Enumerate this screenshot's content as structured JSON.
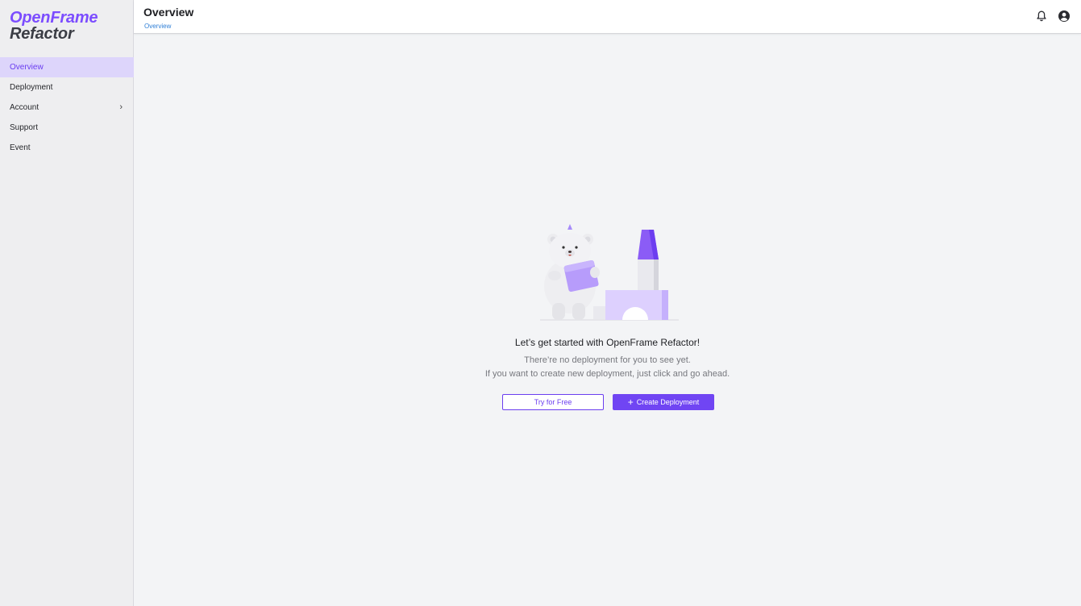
{
  "brand": {
    "line1": "OpenFrame",
    "line2": "Refactor",
    "accent": "#7c4dff"
  },
  "sidebar": {
    "items": [
      {
        "label": "Overview",
        "active": true
      },
      {
        "label": "Deployment"
      },
      {
        "label": "Account",
        "chevron": "chevron-right-icon"
      },
      {
        "label": "Support"
      },
      {
        "label": "Event"
      }
    ]
  },
  "header": {
    "title": "Overview",
    "breadcrumb": "Overview",
    "icons": [
      "bell-icon",
      "user-avatar-icon"
    ]
  },
  "empty_state": {
    "headline": "Let’s get started with OpenFrame Refactor!",
    "line1": "There’re no deployment for you to see yet.",
    "line2": "If you want to create new deployment, just click and go ahead.",
    "try_label": "Try for Free",
    "create_label": "Create Deployment",
    "create_icon": "plus-icon"
  },
  "colors": {
    "primary": "#7045f3",
    "link": "#2f7fd6",
    "sidebar_active_bg": "#ddd5fb"
  }
}
